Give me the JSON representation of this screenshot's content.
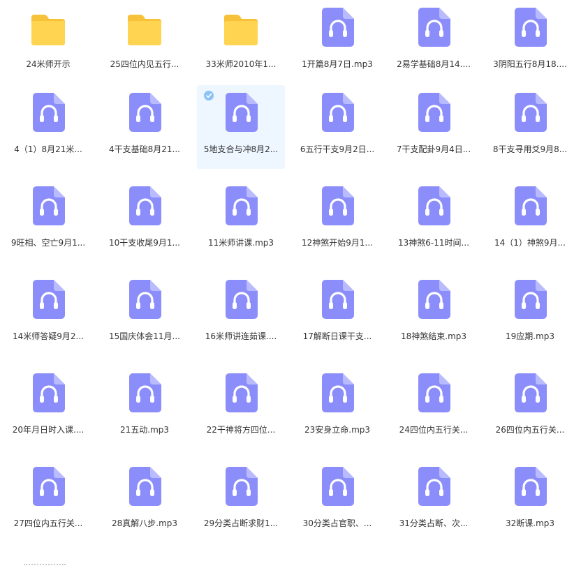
{
  "colors": {
    "folder_front": "#FFD451",
    "folder_back": "#F7C23A",
    "audio_body": "#8B8DFA",
    "audio_fold": "#B9BBFF",
    "audio_glyph": "#FFFFFF",
    "selected_bg": "#EEF6FF",
    "check": "#8CC2F5"
  },
  "files": [
    {
      "name": "24米师开示",
      "type": "folder",
      "icon": "folder-icon"
    },
    {
      "name": "25四位内见五行...",
      "type": "folder",
      "icon": "folder-icon"
    },
    {
      "name": "33米师2010年1...",
      "type": "folder",
      "icon": "folder-icon"
    },
    {
      "name": "1开篇8月7日.mp3",
      "type": "audio",
      "icon": "audio-file-icon"
    },
    {
      "name": "2易学基础8月14....",
      "type": "audio",
      "icon": "audio-file-icon"
    },
    {
      "name": "3阴阳五行8月18....",
      "type": "audio",
      "icon": "audio-file-icon"
    },
    {
      "name": "4（1）8月21米...",
      "type": "audio",
      "icon": "audio-file-icon"
    },
    {
      "name": "4干支基础8月21...",
      "type": "audio",
      "icon": "audio-file-icon"
    },
    {
      "name": "5地支合与冲8月2...",
      "type": "audio",
      "icon": "audio-file-icon",
      "selected": true
    },
    {
      "name": "6五行干支9月2日...",
      "type": "audio",
      "icon": "audio-file-icon"
    },
    {
      "name": "7干支配卦9月4日...",
      "type": "audio",
      "icon": "audio-file-icon"
    },
    {
      "name": "8干支寻用爻9月8...",
      "type": "audio",
      "icon": "audio-file-icon"
    },
    {
      "name": "9旺相、空亡9月1...",
      "type": "audio",
      "icon": "audio-file-icon"
    },
    {
      "name": "10干支收尾9月1...",
      "type": "audio",
      "icon": "audio-file-icon"
    },
    {
      "name": "11米师讲课.mp3",
      "type": "audio",
      "icon": "audio-file-icon"
    },
    {
      "name": "12神煞开始9月1...",
      "type": "audio",
      "icon": "audio-file-icon"
    },
    {
      "name": "13神煞6-11时间...",
      "type": "audio",
      "icon": "audio-file-icon"
    },
    {
      "name": "14（1）神煞9月...",
      "type": "audio",
      "icon": "audio-file-icon"
    },
    {
      "name": "14米师答疑9月2...",
      "type": "audio",
      "icon": "audio-file-icon"
    },
    {
      "name": "15国庆体会11月...",
      "type": "audio",
      "icon": "audio-file-icon"
    },
    {
      "name": "16米师讲连茹课....",
      "type": "audio",
      "icon": "audio-file-icon"
    },
    {
      "name": "17解断日课干支...",
      "type": "audio",
      "icon": "audio-file-icon"
    },
    {
      "name": "18神煞结束.mp3",
      "type": "audio",
      "icon": "audio-file-icon"
    },
    {
      "name": "19应期.mp3",
      "type": "audio",
      "icon": "audio-file-icon"
    },
    {
      "name": "20年月日时入课....",
      "type": "audio",
      "icon": "audio-file-icon"
    },
    {
      "name": "21五动.mp3",
      "type": "audio",
      "icon": "audio-file-icon"
    },
    {
      "name": "22干神将方四位...",
      "type": "audio",
      "icon": "audio-file-icon"
    },
    {
      "name": "23安身立命.mp3",
      "type": "audio",
      "icon": "audio-file-icon"
    },
    {
      "name": "24四位内五行关...",
      "type": "audio",
      "icon": "audio-file-icon"
    },
    {
      "name": "26四位内五行关...",
      "type": "audio",
      "icon": "audio-file-icon"
    },
    {
      "name": "27四位内五行关...",
      "type": "audio",
      "icon": "audio-file-icon"
    },
    {
      "name": "28真解八步.mp3",
      "type": "audio",
      "icon": "audio-file-icon"
    },
    {
      "name": "29分类占断求财1...",
      "type": "audio",
      "icon": "audio-file-icon"
    },
    {
      "name": "30分类占官职、...",
      "type": "audio",
      "icon": "audio-file-icon"
    },
    {
      "name": "31分类占断、次...",
      "type": "audio",
      "icon": "audio-file-icon"
    },
    {
      "name": "32断课.mp3",
      "type": "audio",
      "icon": "audio-file-icon"
    }
  ]
}
